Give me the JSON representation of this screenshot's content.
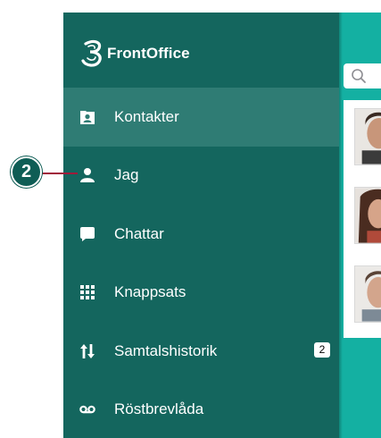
{
  "app": {
    "name": "FrontOffice"
  },
  "menu": {
    "items": [
      {
        "label": "Kontakter",
        "icon": "contact-card-icon",
        "active": true
      },
      {
        "label": "Jag",
        "icon": "person-icon",
        "active": false
      },
      {
        "label": "Chattar",
        "icon": "chat-bubble-icon",
        "active": false
      },
      {
        "label": "Knappsats",
        "icon": "keypad-icon",
        "active": false
      },
      {
        "label": "Samtalshistorik",
        "icon": "call-history-icon",
        "active": false,
        "badge": "2"
      },
      {
        "label": "Röstbrevlåda",
        "icon": "voicemail-icon",
        "active": false
      }
    ]
  },
  "annotation": {
    "callout_number": "2"
  },
  "colors": {
    "sidebar": "#14665e",
    "active_item": "#2f7c74",
    "content_bg": "#14b0a2",
    "callout": "#0e5d55",
    "callout_line": "#a01a3a"
  }
}
